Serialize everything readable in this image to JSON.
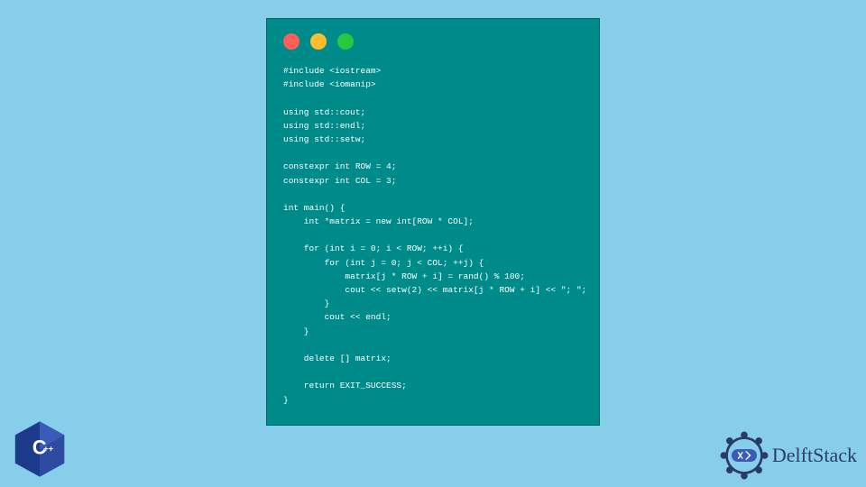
{
  "code": {
    "lines": "#include <iostream>\n#include <iomanip>\n\nusing std::cout;\nusing std::endl;\nusing std::setw;\n\nconstexpr int ROW = 4;\nconstexpr int COL = 3;\n\nint main() {\n    int *matrix = new int[ROW * COL];\n\n    for (int i = 0; i < ROW; ++i) {\n        for (int j = 0; j < COL; ++j) {\n            matrix[j * ROW + i] = rand() % 100;\n            cout << setw(2) << matrix[j * ROW + i] << \"; \";\n        }\n        cout << endl;\n    }\n\n    delete [] matrix;\n\n    return EXIT_SUCCESS;\n}"
  },
  "logos": {
    "cpp_label": "C++",
    "delftstack_label": "DelftStack"
  }
}
